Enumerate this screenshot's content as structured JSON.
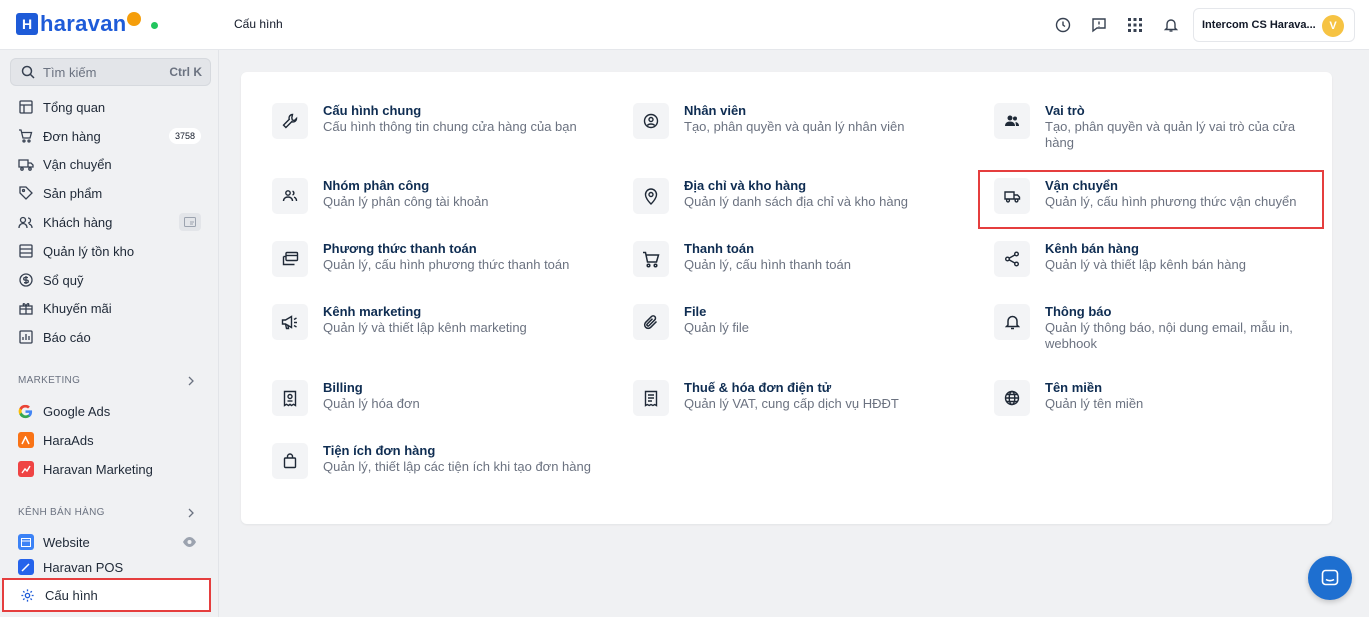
{
  "header": {
    "logo_text": "haravan",
    "logo_letter": "H",
    "breadcrumb": "Cấu hình",
    "account_name": "Intercom CS Harava...",
    "account_initial": "V"
  },
  "sidebar": {
    "search_placeholder": "Tìm kiếm",
    "search_shortcut": "Ctrl K",
    "items": [
      {
        "label": "Tổng quan",
        "icon": "dashboard-icon"
      },
      {
        "label": "Đơn hàng",
        "icon": "cart-icon",
        "badge": "3758"
      },
      {
        "label": "Vận chuyển",
        "icon": "truck-icon"
      },
      {
        "label": "Sản phẩm",
        "icon": "tag-icon"
      },
      {
        "label": "Khách hàng",
        "icon": "users-icon"
      },
      {
        "label": "Quản lý tồn kho",
        "icon": "inventory-icon"
      },
      {
        "label": "Sổ quỹ",
        "icon": "cashbook-icon"
      },
      {
        "label": "Khuyến mãi",
        "icon": "gift-icon"
      },
      {
        "label": "Báo cáo",
        "icon": "report-icon"
      }
    ],
    "marketing_title": "MARKETING",
    "marketing_items": [
      {
        "label": "Google Ads"
      },
      {
        "label": "HaraAds"
      },
      {
        "label": "Haravan Marketing"
      }
    ],
    "sales_title": "KÊNH BÁN HÀNG",
    "sales_items": [
      {
        "label": "Website"
      },
      {
        "label": "Haravan POS"
      }
    ],
    "active_item": "Cấu hình"
  },
  "tiles": [
    {
      "title": "Cấu hình chung",
      "desc": "Cấu hình thông tin chung cửa hàng của bạn",
      "icon": "wrench-icon"
    },
    {
      "title": "Nhân viên",
      "desc": "Tạo, phân quyền và quản lý nhân viên",
      "icon": "user-circle-icon"
    },
    {
      "title": "Vai trò",
      "desc": "Tạo, phân quyền và quản lý vai trò của cửa hàng",
      "icon": "roles-icon"
    },
    {
      "title": "Nhóm phân công",
      "desc": "Quản lý phân công tài khoản",
      "icon": "group-icon"
    },
    {
      "title": "Địa chỉ và kho hàng",
      "desc": "Quản lý danh sách địa chỉ và kho hàng",
      "icon": "location-pin-icon"
    },
    {
      "title": "Vận chuyển",
      "desc": "Quản lý, cấu hình phương thức vận chuyển",
      "icon": "truck-icon"
    },
    {
      "title": "Phương thức thanh toán",
      "desc": "Quản lý, cấu hình phương thức thanh toán",
      "icon": "payment-card-icon"
    },
    {
      "title": "Thanh toán",
      "desc": "Quản lý, cấu hình thanh toán",
      "icon": "checkout-cart-icon"
    },
    {
      "title": "Kênh bán hàng",
      "desc": "Quản lý và thiết lập kênh bán hàng",
      "icon": "share-icon"
    },
    {
      "title": "Kênh marketing",
      "desc": "Quản lý và thiết lập kênh marketing",
      "icon": "megaphone-icon"
    },
    {
      "title": "File",
      "desc": "Quản lý file",
      "icon": "paperclip-icon"
    },
    {
      "title": "Thông báo",
      "desc": "Quản lý thông báo, nội dung email, mẫu in, webhook",
      "icon": "bell-icon"
    },
    {
      "title": "Billing",
      "desc": "Quản lý hóa đơn",
      "icon": "receipt-icon"
    },
    {
      "title": "Thuế & hóa đơn điện tử",
      "desc": "Quản lý VAT, cung cấp dịch vụ HĐĐT",
      "icon": "invoice-icon"
    },
    {
      "title": "Tên miền",
      "desc": "Quản lý tên miền",
      "icon": "globe-icon"
    },
    {
      "title": "Tiện ích đơn hàng",
      "desc": "Quản lý, thiết lập các tiện ích khi tạo đơn hàng",
      "icon": "shopping-bag-icon"
    }
  ]
}
